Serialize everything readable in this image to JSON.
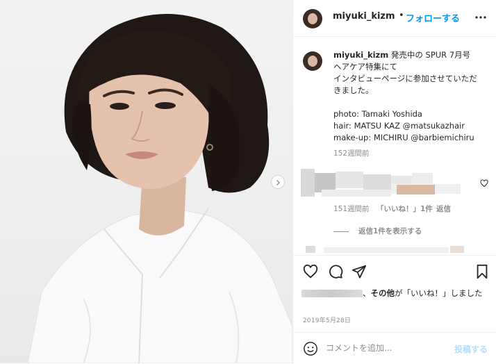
{
  "post": {
    "username": "miyuki_kizm",
    "separator": "•",
    "follow_label": "フォローする",
    "caption_lines": [
      "発売中の SPUR 7月号",
      "ヘアケア特集にて",
      "インタビューページに参加させていただ",
      "きました。",
      "",
      "photo: Tamaki Yoshida",
      "hair: MATSU KAZ @matsukazhair",
      "make-up: MICHIRU @barbiemichiru"
    ],
    "caption_age": "152週間前",
    "comment": {
      "age": "151週間前",
      "likes": "「いいね！」1件",
      "reply_label": "返信",
      "view_replies": "返信1件を表示する"
    },
    "likes_suffix_bold": "その他",
    "likes_text": "が「いいね！」しました",
    "likes_prefix": "、",
    "date": "2019年5月28日",
    "add_comment_placeholder": "コメントを追加...",
    "post_button": "投稿する"
  },
  "icons": {
    "more": "more-horizontal-icon",
    "carousel_next": "chevron-right-icon",
    "comment_like": "heart-outline-icon",
    "like": "heart-icon",
    "comment": "comment-bubble-icon",
    "share": "paper-plane-icon",
    "save": "bookmark-icon",
    "emoji": "smiley-icon"
  },
  "colors": {
    "accent": "#0095f6",
    "muted": "#8e8e8e",
    "text": "#262626",
    "post_disabled": "#b2dffc"
  }
}
